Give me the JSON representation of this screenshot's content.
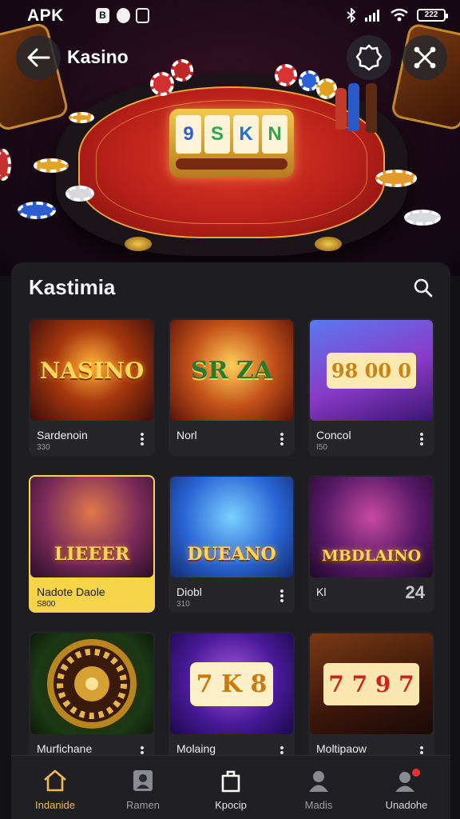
{
  "status_bar": {
    "left_text": "APK",
    "notif_1": "B",
    "battery": "222"
  },
  "header": {
    "title": "Kasino"
  },
  "hero": {
    "slot_symbols": [
      "9",
      "S",
      "K",
      "N"
    ]
  },
  "panel": {
    "title": "Kastimia"
  },
  "games": [
    {
      "name": "Sardenoin",
      "sub": "330",
      "thumb_text": "NASINO",
      "thumb_sub": "",
      "highlight": false,
      "count": ""
    },
    {
      "name": "Norl",
      "sub": "",
      "thumb_text": "SR ZA",
      "thumb_sub": "",
      "highlight": false,
      "count": ""
    },
    {
      "name": "Concol",
      "sub": "I50",
      "thumb_text": "98 00 0",
      "thumb_sub": "",
      "highlight": false,
      "count": ""
    },
    {
      "name": "Nadote Daole",
      "sub": "S800",
      "thumb_text": "LIEEER",
      "thumb_sub": "",
      "highlight": true,
      "count": ""
    },
    {
      "name": "Diobl",
      "sub": "310",
      "thumb_text": "DUEANO",
      "thumb_sub": "",
      "highlight": false,
      "count": ""
    },
    {
      "name": "Kl",
      "sub": "",
      "thumb_text": "MBDLAINO",
      "thumb_sub": "",
      "highlight": false,
      "count": "24"
    },
    {
      "name": "Murfichane",
      "sub": "",
      "thumb_text": "",
      "thumb_sub": "",
      "highlight": false,
      "count": ""
    },
    {
      "name": "Molaing",
      "sub": "",
      "thumb_text": "7 K 8",
      "thumb_sub": "",
      "highlight": false,
      "count": ""
    },
    {
      "name": "Moltipaow",
      "sub": "",
      "thumb_text": "7 7 9 7",
      "thumb_sub": "",
      "highlight": false,
      "count": ""
    }
  ],
  "bottom_nav": [
    {
      "label": "Indanide",
      "icon": "home-icon",
      "active": true
    },
    {
      "label": "Ramen",
      "icon": "profile-card-icon",
      "active": false
    },
    {
      "label": "Kpocip",
      "icon": "bag-icon",
      "active": false
    },
    {
      "label": "Madis",
      "icon": "person-icon",
      "active": false
    },
    {
      "label": "Unadohe",
      "icon": "profile-badge-icon",
      "active": false
    }
  ],
  "colors": {
    "accent": "#f2b84b",
    "highlight_card": "#f6d44a",
    "panel_bg": "#1e1e22",
    "felt": "#c8261d"
  }
}
